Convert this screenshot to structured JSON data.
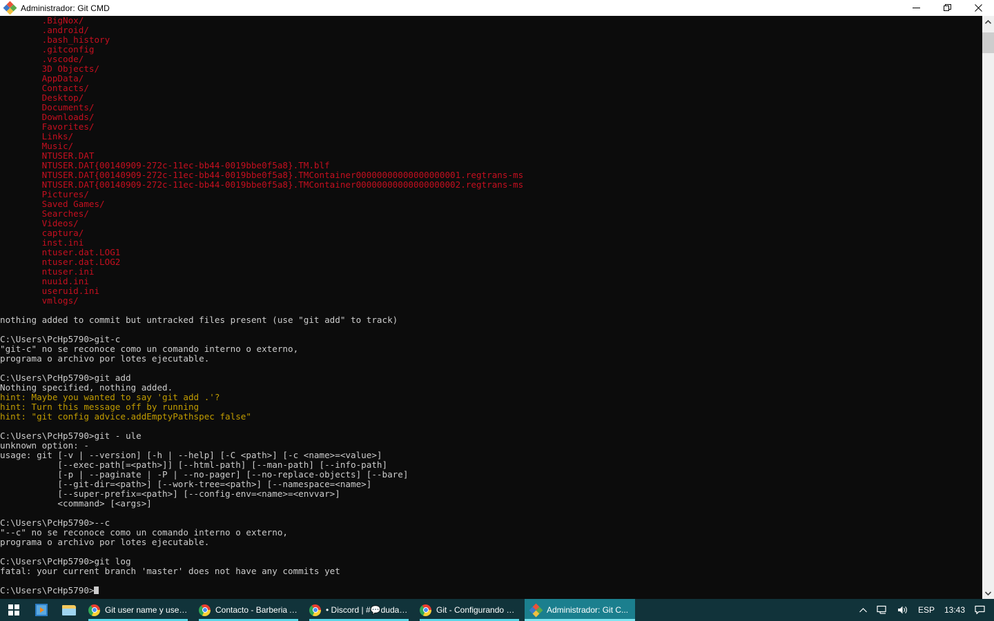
{
  "window": {
    "title": "Administrador: Git CMD",
    "icon": "git-diamond-icon",
    "controls": {
      "minimize": "minimize-button",
      "restore": "restore-button",
      "close": "close-button"
    }
  },
  "console": {
    "prompt": "C:\\Users\\PcHp5790>",
    "colors": {
      "background": "#0c0c0c",
      "default_text": "#cccccc",
      "untracked_red": "#c50f1f",
      "hint_yellow": "#c19c00"
    },
    "lines": [
      {
        "color": "red",
        "text": "        .BigNox/"
      },
      {
        "color": "red",
        "text": "        .android/"
      },
      {
        "color": "red",
        "text": "        .bash_history"
      },
      {
        "color": "red",
        "text": "        .gitconfig"
      },
      {
        "color": "red",
        "text": "        .vscode/"
      },
      {
        "color": "red",
        "text": "        3D Objects/"
      },
      {
        "color": "red",
        "text": "        AppData/"
      },
      {
        "color": "red",
        "text": "        Contacts/"
      },
      {
        "color": "red",
        "text": "        Desktop/"
      },
      {
        "color": "red",
        "text": "        Documents/"
      },
      {
        "color": "red",
        "text": "        Downloads/"
      },
      {
        "color": "red",
        "text": "        Favorites/"
      },
      {
        "color": "red",
        "text": "        Links/"
      },
      {
        "color": "red",
        "text": "        Music/"
      },
      {
        "color": "red",
        "text": "        NTUSER.DAT"
      },
      {
        "color": "red",
        "text": "        NTUSER.DAT{00140909-272c-11ec-bb44-0019bbe0f5a8}.TM.blf"
      },
      {
        "color": "red",
        "text": "        NTUSER.DAT{00140909-272c-11ec-bb44-0019bbe0f5a8}.TMContainer00000000000000000001.regtrans-ms"
      },
      {
        "color": "red",
        "text": "        NTUSER.DAT{00140909-272c-11ec-bb44-0019bbe0f5a8}.TMContainer00000000000000000002.regtrans-ms"
      },
      {
        "color": "red",
        "text": "        Pictures/"
      },
      {
        "color": "red",
        "text": "        Saved Games/"
      },
      {
        "color": "red",
        "text": "        Searches/"
      },
      {
        "color": "red",
        "text": "        Videos/"
      },
      {
        "color": "red",
        "text": "        captura/"
      },
      {
        "color": "red",
        "text": "        inst.ini"
      },
      {
        "color": "red",
        "text": "        ntuser.dat.LOG1"
      },
      {
        "color": "red",
        "text": "        ntuser.dat.LOG2"
      },
      {
        "color": "red",
        "text": "        ntuser.ini"
      },
      {
        "color": "red",
        "text": "        nuuid.ini"
      },
      {
        "color": "red",
        "text": "        useruid.ini"
      },
      {
        "color": "red",
        "text": "        vmlogs/"
      },
      {
        "color": "white",
        "text": ""
      },
      {
        "color": "white",
        "text": "nothing added to commit but untracked files present (use \"git add\" to track)"
      },
      {
        "color": "white",
        "text": ""
      },
      {
        "color": "white",
        "text": "C:\\Users\\PcHp5790>git-c"
      },
      {
        "color": "white",
        "text": "\"git-c\" no se reconoce como un comando interno o externo,"
      },
      {
        "color": "white",
        "text": "programa o archivo por lotes ejecutable."
      },
      {
        "color": "white",
        "text": ""
      },
      {
        "color": "white",
        "text": "C:\\Users\\PcHp5790>git add"
      },
      {
        "color": "white",
        "text": "Nothing specified, nothing added."
      },
      {
        "color": "yellow",
        "text": "hint: Maybe you wanted to say 'git add .'?"
      },
      {
        "color": "yellow",
        "text": "hint: Turn this message off by running"
      },
      {
        "color": "yellow",
        "text": "hint: \"git config advice.addEmptyPathspec false\""
      },
      {
        "color": "white",
        "text": ""
      },
      {
        "color": "white",
        "text": "C:\\Users\\PcHp5790>git - ule"
      },
      {
        "color": "white",
        "text": "unknown option: -"
      },
      {
        "color": "white",
        "text": "usage: git [-v | --version] [-h | --help] [-C <path>] [-c <name>=<value>]"
      },
      {
        "color": "white",
        "text": "           [--exec-path[=<path>]] [--html-path] [--man-path] [--info-path]"
      },
      {
        "color": "white",
        "text": "           [-p | --paginate | -P | --no-pager] [--no-replace-objects] [--bare]"
      },
      {
        "color": "white",
        "text": "           [--git-dir=<path>] [--work-tree=<path>] [--namespace=<name>]"
      },
      {
        "color": "white",
        "text": "           [--super-prefix=<path>] [--config-env=<name>=<envvar>]"
      },
      {
        "color": "white",
        "text": "           <command> [<args>]"
      },
      {
        "color": "white",
        "text": ""
      },
      {
        "color": "white",
        "text": "C:\\Users\\PcHp5790>--c"
      },
      {
        "color": "white",
        "text": "\"--c\" no se reconoce como un comando interno o externo,"
      },
      {
        "color": "white",
        "text": "programa o archivo por lotes ejecutable."
      },
      {
        "color": "white",
        "text": ""
      },
      {
        "color": "white",
        "text": "C:\\Users\\PcHp5790>git log"
      },
      {
        "color": "white",
        "text": "fatal: your current branch 'master' does not have any commits yet"
      },
      {
        "color": "white",
        "text": ""
      },
      {
        "color": "white",
        "text": "C:\\Users\\PcHp5790>",
        "cursor": true
      }
    ]
  },
  "scrollbar": {
    "up_arrow": "scroll-up-icon",
    "down_arrow": "scroll-down-icon"
  },
  "taskbar": {
    "start": "windows-logo-icon",
    "quick_launch": [
      {
        "name": "media-player-icon"
      },
      {
        "name": "file-explorer-icon"
      }
    ],
    "items": [
      {
        "label": "Git user name y user ...",
        "icon": "chrome-icon",
        "active": false
      },
      {
        "label": "Contacto - Barberia A...",
        "icon": "chrome-icon",
        "active": false
      },
      {
        "label": "• Discord | #💬dudas...",
        "icon": "chrome-icon",
        "active": false
      },
      {
        "label": "Git - Configurando Gi...",
        "icon": "chrome-icon",
        "active": false
      },
      {
        "label": "Administrador: Git C...",
        "icon": "git-diamond-icon",
        "active": true
      }
    ],
    "tray": {
      "show_hidden": "chevron-up-icon",
      "network": "network-icon",
      "volume": "volume-icon",
      "language": "ESP",
      "clock": "13:43",
      "action_center": "notification-icon"
    }
  }
}
